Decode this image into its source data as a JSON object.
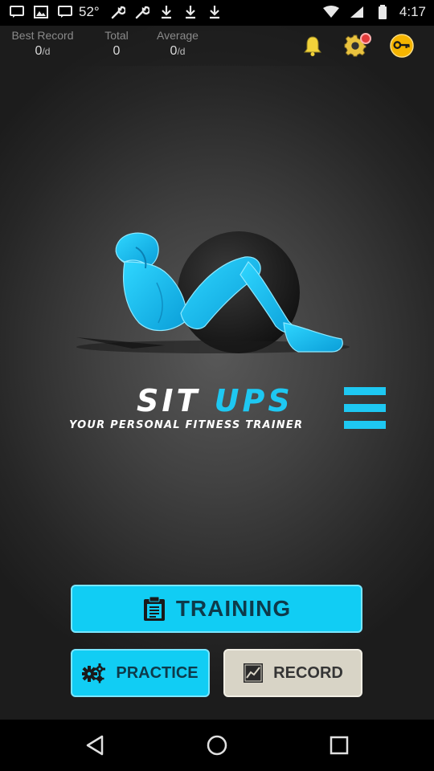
{
  "status_bar": {
    "temperature": "52°",
    "time": "4:17",
    "icons": [
      "message-icon",
      "image-icon",
      "message-icon",
      "wrench-icon",
      "wrench-icon",
      "download-icon",
      "download-icon",
      "download-icon",
      "wifi-icon",
      "signal-icon",
      "battery-icon"
    ]
  },
  "stats": {
    "best_record": {
      "label": "Best Record",
      "value": "0",
      "unit": "/d"
    },
    "total": {
      "label": "Total",
      "value": "0"
    },
    "average": {
      "label": "Average",
      "value": "0",
      "unit": "/d"
    }
  },
  "header_icons": [
    "bell-icon",
    "gear-icon",
    "key-icon"
  ],
  "logo": {
    "title_sit": "SIT",
    "title_ups": "UPS",
    "subtitle": "YOUR PERSONAL FITNESS TRAINER"
  },
  "buttons": {
    "training": "TRAINING",
    "practice": "PRACTICE",
    "record": "RECORD"
  },
  "nav": [
    "back-icon",
    "home-icon",
    "recents-icon"
  ],
  "colors": {
    "accent": "#11cdf4",
    "record_button": "#d8d4c6",
    "badge": "#e23b3b",
    "key_icon": "#f5b400"
  }
}
